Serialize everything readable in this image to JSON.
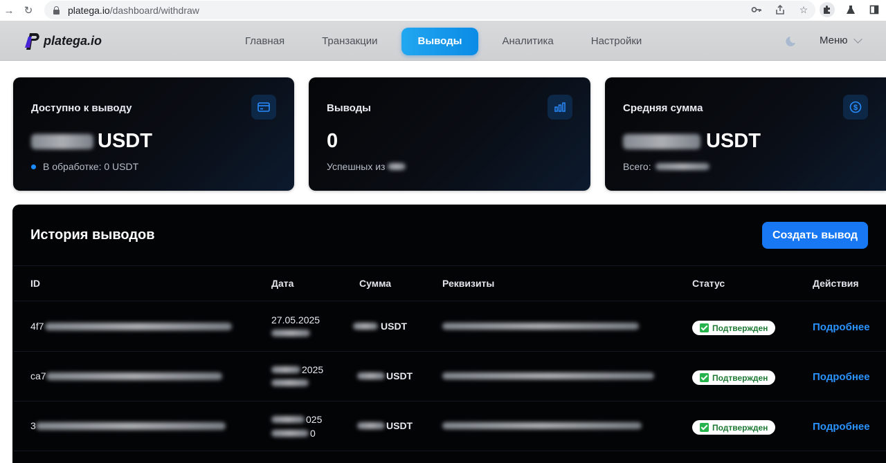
{
  "browser": {
    "url_host": "platega.io",
    "url_path": "/dashboard/withdraw"
  },
  "header": {
    "logo_text": "platega.io",
    "nav": [
      {
        "label": "Главная"
      },
      {
        "label": "Транзакции"
      },
      {
        "label": "Выводы",
        "active": true
      },
      {
        "label": "Аналитика"
      },
      {
        "label": "Настройки"
      }
    ],
    "menu_label": "Меню",
    "accent_color": "#1a9bf0"
  },
  "cards": {
    "available": {
      "title": "Доступно к выводу",
      "icon": "credit-card-icon",
      "currency": "USDT",
      "processing": "В обработке: 0 USDT"
    },
    "withdrawals": {
      "title": "Выводы",
      "icon": "bar-chart-icon",
      "value": "0",
      "sub": "Успешных из"
    },
    "average": {
      "title": "Средняя сумма",
      "icon": "dollar-circle-icon",
      "currency": "USDT",
      "total_label": "Всего:"
    }
  },
  "history": {
    "title": "История выводов",
    "create_button": "Создать вывод",
    "columns": {
      "id": "ID",
      "date": "Дата",
      "amount": "Сумма",
      "requisites": "Реквизиты",
      "status": "Статус",
      "actions": "Действия"
    },
    "rows": [
      {
        "id_prefix": "4f7",
        "date_line1": "27.05.2025",
        "amount": "USDT",
        "status": "Подтвержден",
        "action": "Подробнее"
      },
      {
        "id_prefix": "ca7",
        "date_line1": "2025",
        "amount": "USDT",
        "status": "Подтвержден",
        "action": "Подробнее"
      },
      {
        "id_prefix": "3",
        "date_line1": "025",
        "date_line2": "0",
        "amount": "USDT",
        "status": "Подтвержден",
        "action": "Подробнее"
      }
    ],
    "status_color": "#27b34b",
    "link_color": "#2a93ff",
    "button_color": "#1877f2"
  }
}
